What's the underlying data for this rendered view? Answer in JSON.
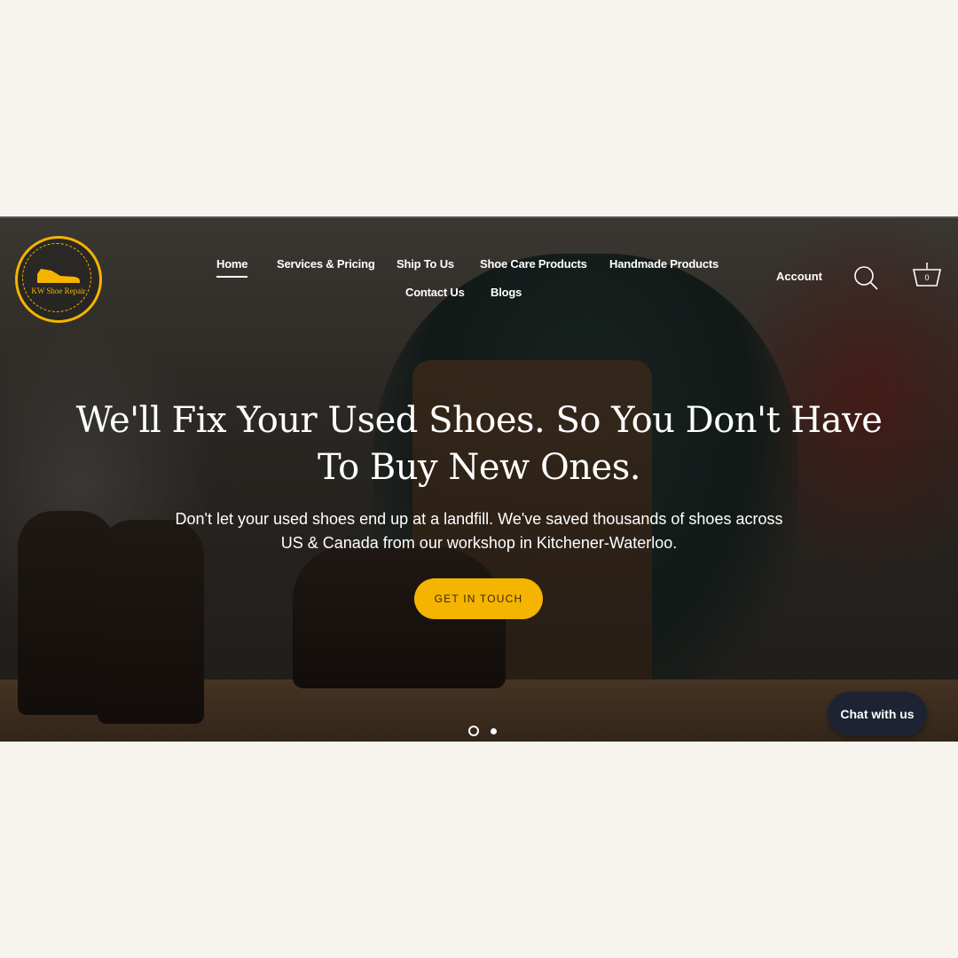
{
  "logo": {
    "text": "KW Shoe Repair",
    "accent": "#f4b400"
  },
  "nav": {
    "items": [
      {
        "label": "Home",
        "active": true
      },
      {
        "label": "Services & Pricing"
      },
      {
        "label": "Ship To Us"
      },
      {
        "label": "Shoe Care Products"
      },
      {
        "label": "Handmade Products"
      },
      {
        "label": "Contact Us"
      },
      {
        "label": "Blogs"
      }
    ]
  },
  "header": {
    "account_label": "Account",
    "search_icon": "search-icon",
    "cart_icon": "basket-icon",
    "cart_count": "0"
  },
  "hero": {
    "headline": "We'll Fix Your Used Shoes. So You Don't Have To Buy New Ones.",
    "subtext": "Don't let your used shoes end up at a landfill. We've saved thousands of shoes across US & Canada from our workshop in Kitchener-Waterloo.",
    "cta_label": "GET IN TOUCH",
    "cta_color": "#f4b400",
    "slides": {
      "count": 2,
      "current": 1
    }
  },
  "chat": {
    "label": "Chat with us",
    "color": "#1d2333"
  }
}
